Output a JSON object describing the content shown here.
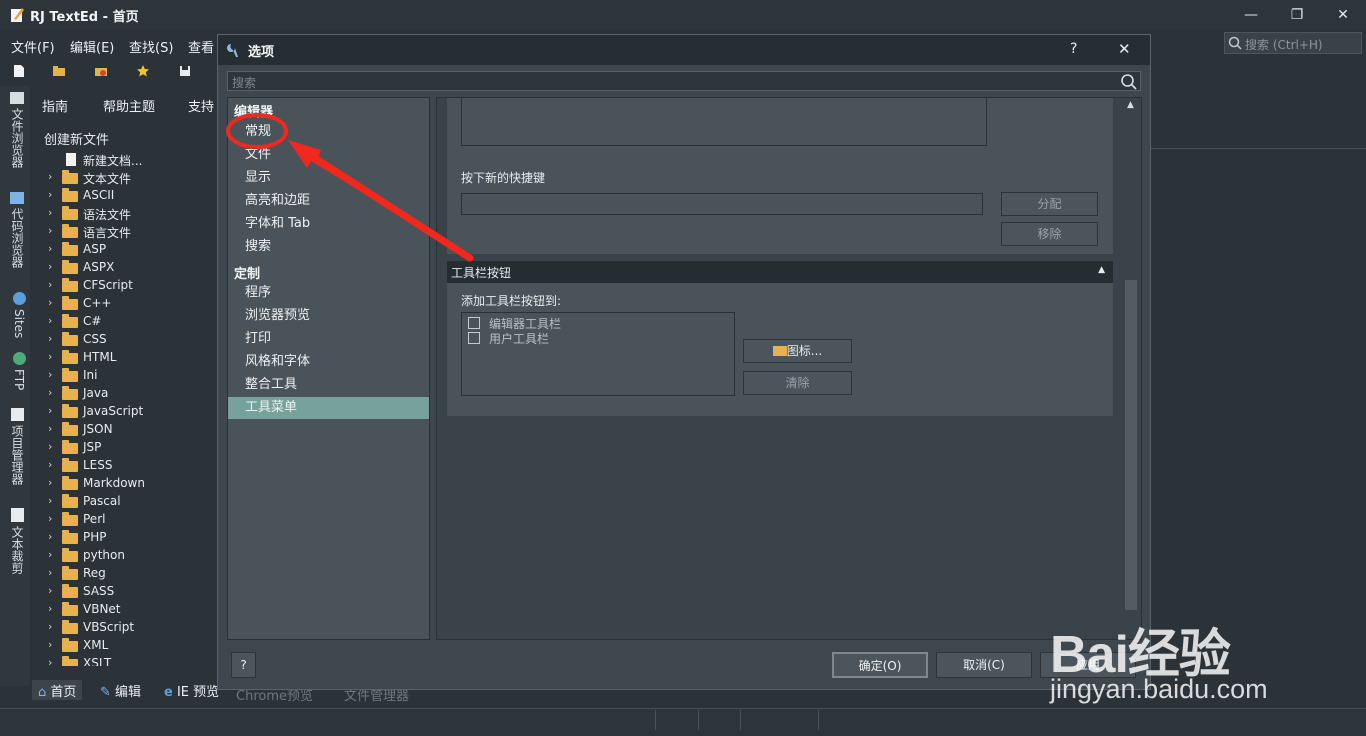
{
  "app": {
    "title": "RJ TextEd - 首页",
    "minimize_glyph": "—",
    "restore_glyph": "❐",
    "close_glyph": "✕"
  },
  "menubar": {
    "items": [
      "文件(F)",
      "编辑(E)",
      "查找(S)",
      "查看"
    ],
    "search_placeholder": "搜索 (Ctrl+H)"
  },
  "side_tabs": [
    "文件浏览器",
    "代码浏览器",
    "Sites",
    "FTP",
    "项目管理器",
    "文本裁剪"
  ],
  "sub_toolbar": {
    "items": [
      "指南",
      "帮助主题",
      "支持"
    ]
  },
  "file_tree": {
    "title": "创建新文件",
    "new_doc": "新建文档...",
    "folders": [
      "文本文件",
      "ASCII",
      "语法文件",
      "语言文件",
      "ASP",
      "ASPX",
      "CFScript",
      "C++",
      "C#",
      "CSS",
      "HTML",
      "Ini",
      "Java",
      "JavaScript",
      "JSON",
      "JSP",
      "LESS",
      "Markdown",
      "Pascal",
      "Perl",
      "PHP",
      "python",
      "Reg",
      "SASS",
      "VBNet",
      "VBScript",
      "XML",
      "XSLT"
    ]
  },
  "bottom_tabs": [
    "首页",
    "编辑",
    "IE 预览",
    "Chrome预览",
    "文件管理器"
  ],
  "dialog": {
    "title": "选项",
    "help_glyph": "?",
    "close_glyph": "✕",
    "search_placeholder": "搜索",
    "nav": {
      "group1": "编辑器",
      "group1_items": [
        "常规",
        "文件",
        "显示",
        "高亮和边距",
        "字体和 Tab",
        "搜索"
      ],
      "group2": "定制",
      "group2_items": [
        "程序",
        "浏览器预览",
        "打印",
        "风格和字体",
        "整合工具",
        "工具菜单"
      ],
      "selected": "工具菜单"
    },
    "shortcut": {
      "label": "按下新的快捷键",
      "assign_button": "分配",
      "remove_button": "移除"
    },
    "toolbar_section": {
      "header": "工具栏按钮",
      "add_label": "添加工具栏按钮到:",
      "options": [
        "编辑器工具栏",
        "用户工具栏"
      ],
      "icon_button": "图标...",
      "clear_button": "清除"
    },
    "footer": {
      "help_button": "?",
      "ok_button": "确定(O)",
      "cancel_button": "取消(C)",
      "apply_button": "应用"
    }
  },
  "watermark": {
    "brand": "Bai经验",
    "url": "jingyan.baidu.com"
  },
  "colors": {
    "accent_selected": "#76a29b",
    "annotation_red": "#f0281e",
    "folder": "#e8b14e"
  }
}
